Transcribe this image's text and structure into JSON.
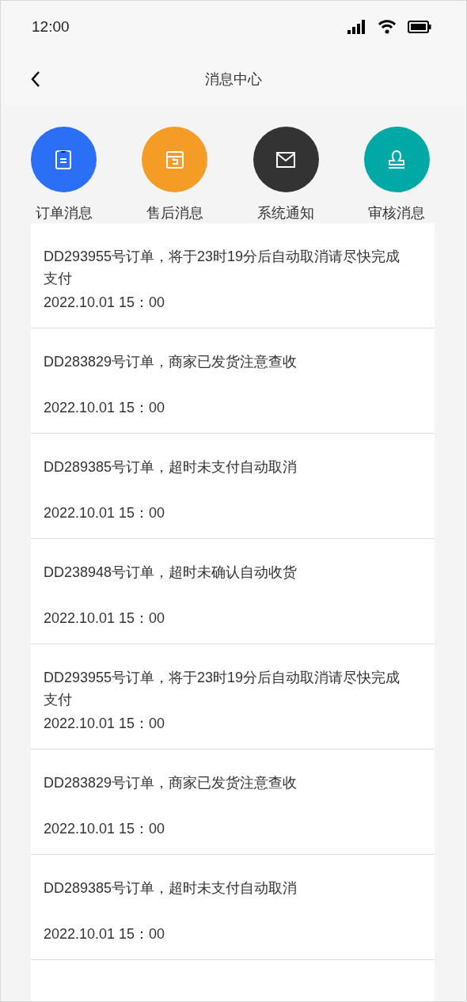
{
  "status_bar": {
    "time": "12:00"
  },
  "nav_bar": {
    "title": "消息中心"
  },
  "categories": [
    {
      "label": "订单消息",
      "kind": "order",
      "color": "#2b6ff6"
    },
    {
      "label": "售后消息",
      "kind": "aftersale",
      "color": "#f49c25"
    },
    {
      "label": "系统通知",
      "kind": "system",
      "color": "#333333"
    },
    {
      "label": "审核消息",
      "kind": "review",
      "color": "#00a8a6"
    }
  ],
  "messages": [
    {
      "text": "DD293955号订单，将于23时19分后自动取消请尽快完成支付",
      "time": "2022.10.01 15：00"
    },
    {
      "text": "DD283829号订单，商家已发货注意查收",
      "time": "2022.10.01 15：00"
    },
    {
      "text": "DD289385号订单，超时未支付自动取消",
      "time": "2022.10.01 15：00"
    },
    {
      "text": "DD238948号订单，超时未确认自动收货",
      "time": "2022.10.01 15：00"
    },
    {
      "text": "DD293955号订单，将于23时19分后自动取消请尽快完成支付",
      "time": "2022.10.01 15：00"
    },
    {
      "text": "DD283829号订单，商家已发货注意查收",
      "time": "2022.10.01 15：00"
    },
    {
      "text": "DD289385号订单，超时未支付自动取消",
      "time": "2022.10.01 15：00"
    }
  ]
}
